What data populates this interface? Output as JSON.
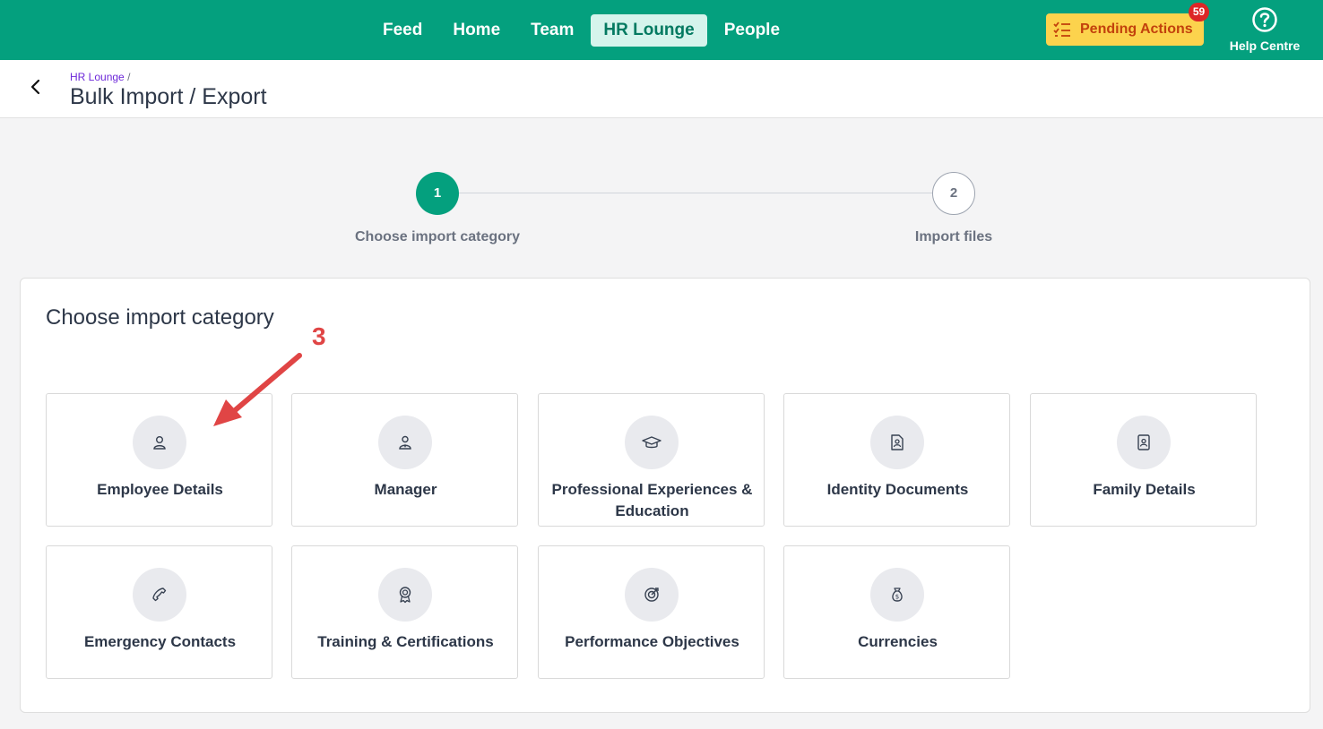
{
  "nav": {
    "items": [
      {
        "label": "Feed",
        "active": false
      },
      {
        "label": "Home",
        "active": false
      },
      {
        "label": "Team",
        "active": false
      },
      {
        "label": "HR Lounge",
        "active": true
      },
      {
        "label": "People",
        "active": false
      }
    ],
    "pending_label": "Pending Actions",
    "pending_count": "59",
    "help_label": "Help Centre"
  },
  "header": {
    "breadcrumb_link": "HR Lounge",
    "breadcrumb_sep": "/",
    "title": "Bulk Import / Export"
  },
  "stepper": {
    "steps": [
      {
        "number": "1",
        "label": "Choose import category",
        "active": true
      },
      {
        "number": "2",
        "label": "Import files",
        "active": false
      }
    ]
  },
  "main": {
    "title": "Choose import category",
    "categories": [
      {
        "label": "Employee Details",
        "icon": "user-icon"
      },
      {
        "label": "Manager",
        "icon": "manager-icon"
      },
      {
        "label": "Professional Experiences & Education",
        "icon": "graduation-cap-icon"
      },
      {
        "label": "Identity Documents",
        "icon": "id-document-icon"
      },
      {
        "label": "Family Details",
        "icon": "contact-card-icon"
      },
      {
        "label": "Emergency Contacts",
        "icon": "phone-icon"
      },
      {
        "label": "Training & Certifications",
        "icon": "award-icon"
      },
      {
        "label": "Performance Objectives",
        "icon": "target-icon"
      },
      {
        "label": "Currencies",
        "icon": "money-bag-icon"
      }
    ]
  },
  "annotation": {
    "step_number": "3"
  },
  "colors": {
    "brand": "#04a07e",
    "active_nav_bg": "#d5f4ec",
    "pending_bg": "#fcd34d",
    "badge": "#dc2626",
    "annotation": "#e04545"
  }
}
